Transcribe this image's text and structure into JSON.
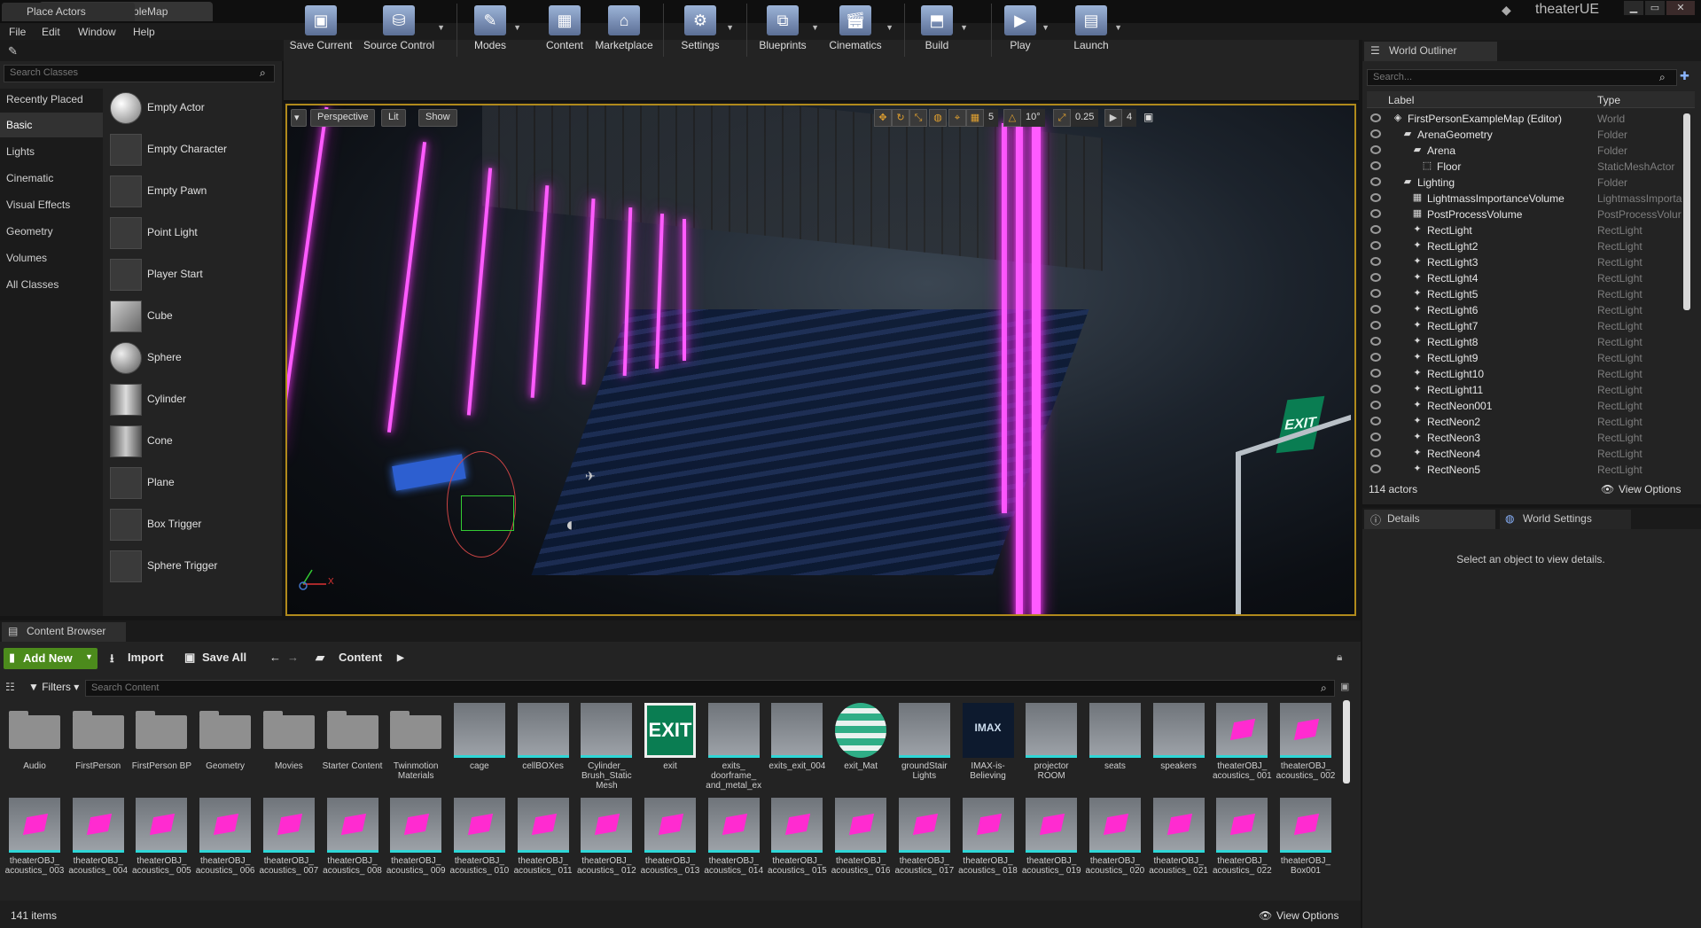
{
  "window": {
    "tab": "FirstPersonExampleMap",
    "project": "theaterUE",
    "min": "▁",
    "max": "▭",
    "close": "✕"
  },
  "menu": [
    "File",
    "Edit",
    "Window",
    "Help"
  ],
  "place_actors": {
    "tab": "Place Actors",
    "search_placeholder": "Search Classes",
    "categories": [
      "Recently Placed",
      "Basic",
      "Lights",
      "Cinematic",
      "Visual Effects",
      "Geometry",
      "Volumes",
      "All Classes"
    ],
    "actors": [
      "Empty Actor",
      "Empty Character",
      "Empty Pawn",
      "Point Light",
      "Player Start",
      "Cube",
      "Sphere",
      "Cylinder",
      "Cone",
      "Plane",
      "Box Trigger",
      "Sphere Trigger"
    ]
  },
  "toolbar": [
    "Save Current",
    "Source Control",
    "Modes",
    "Content",
    "Marketplace",
    "Settings",
    "Blueprints",
    "Cinematics",
    "Build",
    "Play",
    "Launch"
  ],
  "viewport": {
    "perspective": "Perspective",
    "lit": "Lit",
    "show": "Show",
    "grid": "5",
    "angle": "10°",
    "scale": "0.25",
    "cam_speed": "4",
    "exit_text": "EXIT",
    "axis_x": "X"
  },
  "outliner": {
    "tab": "World Outliner",
    "search_placeholder": "Search...",
    "col_label": "Label",
    "col_type": "Type",
    "rows": [
      {
        "label": "FirstPersonExampleMap (Editor)",
        "type": "World"
      },
      {
        "label": "ArenaGeometry",
        "type": "Folder"
      },
      {
        "label": "Arena",
        "type": "Folder"
      },
      {
        "label": "Floor",
        "type": "StaticMeshActor"
      },
      {
        "label": "Lighting",
        "type": "Folder"
      },
      {
        "label": "LightmassImportanceVolume",
        "type": "LightmassImporta"
      },
      {
        "label": "PostProcessVolume",
        "type": "PostProcessVolur"
      },
      {
        "label": "RectLight",
        "type": "RectLight"
      },
      {
        "label": "RectLight2",
        "type": "RectLight"
      },
      {
        "label": "RectLight3",
        "type": "RectLight"
      },
      {
        "label": "RectLight4",
        "type": "RectLight"
      },
      {
        "label": "RectLight5",
        "type": "RectLight"
      },
      {
        "label": "RectLight6",
        "type": "RectLight"
      },
      {
        "label": "RectLight7",
        "type": "RectLight"
      },
      {
        "label": "RectLight8",
        "type": "RectLight"
      },
      {
        "label": "RectLight9",
        "type": "RectLight"
      },
      {
        "label": "RectLight10",
        "type": "RectLight"
      },
      {
        "label": "RectLight11",
        "type": "RectLight"
      },
      {
        "label": "RectNeon001",
        "type": "RectLight"
      },
      {
        "label": "RectNeon2",
        "type": "RectLight"
      },
      {
        "label": "RectNeon3",
        "type": "RectLight"
      },
      {
        "label": "RectNeon4",
        "type": "RectLight"
      },
      {
        "label": "RectNeon5",
        "type": "RectLight"
      }
    ],
    "count": "114 actors",
    "view_options": "View Options"
  },
  "details": {
    "tab": "Details",
    "tab2": "World Settings",
    "empty": "Select an object to view details."
  },
  "content_browser": {
    "tab": "Content Browser",
    "add_new": "Add New",
    "import": "Import",
    "save_all": "Save All",
    "path": "Content",
    "filters": "Filters",
    "search_placeholder": "Search Content",
    "count": "141 items",
    "view_options": "View Options",
    "row1": [
      {
        "label": "Audio",
        "kind": "folder"
      },
      {
        "label": "FirstPerson",
        "kind": "folder"
      },
      {
        "label": "FirstPerson BP",
        "kind": "folder"
      },
      {
        "label": "Geometry",
        "kind": "folder"
      },
      {
        "label": "Movies",
        "kind": "folder"
      },
      {
        "label": "Starter Content",
        "kind": "folder"
      },
      {
        "label": "Twinmotion Materials",
        "kind": "folder"
      },
      {
        "label": "cage",
        "kind": "mesh"
      },
      {
        "label": "cellBOXes",
        "kind": "mesh"
      },
      {
        "label": "Cylinder_ Brush_Static Mesh",
        "kind": "mesh"
      },
      {
        "label": "exit",
        "kind": "exit"
      },
      {
        "label": "exits_ doorframe_ and_metal_ex",
        "kind": "mesh"
      },
      {
        "label": "exits_exit_004",
        "kind": "mesh"
      },
      {
        "label": "exit_Mat",
        "kind": "sphere"
      },
      {
        "label": "groundStair Lights",
        "kind": "mesh"
      },
      {
        "label": "IMAX-is- Believing",
        "kind": "imax"
      },
      {
        "label": "projector ROOM",
        "kind": "mesh"
      },
      {
        "label": "seats",
        "kind": "mesh"
      },
      {
        "label": "speakers",
        "kind": "mesh"
      },
      {
        "label": "theaterOBJ_ acoustics_ 001",
        "kind": "pink"
      },
      {
        "label": "theaterOBJ_ acoustics_ 002",
        "kind": "pink"
      }
    ],
    "row2": [
      {
        "label": "theaterOBJ_ acoustics_ 003"
      },
      {
        "label": "theaterOBJ_ acoustics_ 004"
      },
      {
        "label": "theaterOBJ_ acoustics_ 005"
      },
      {
        "label": "theaterOBJ_ acoustics_ 006"
      },
      {
        "label": "theaterOBJ_ acoustics_ 007"
      },
      {
        "label": "theaterOBJ_ acoustics_ 008"
      },
      {
        "label": "theaterOBJ_ acoustics_ 009"
      },
      {
        "label": "theaterOBJ_ acoustics_ 010"
      },
      {
        "label": "theaterOBJ_ acoustics_ 011"
      },
      {
        "label": "theaterOBJ_ acoustics_ 012"
      },
      {
        "label": "theaterOBJ_ acoustics_ 013"
      },
      {
        "label": "theaterOBJ_ acoustics_ 014"
      },
      {
        "label": "theaterOBJ_ acoustics_ 015"
      },
      {
        "label": "theaterOBJ_ acoustics_ 016"
      },
      {
        "label": "theaterOBJ_ acoustics_ 017"
      },
      {
        "label": "theaterOBJ_ acoustics_ 018"
      },
      {
        "label": "theaterOBJ_ acoustics_ 019"
      },
      {
        "label": "theaterOBJ_ acoustics_ 020"
      },
      {
        "label": "theaterOBJ_ acoustics_ 021"
      },
      {
        "label": "theaterOBJ_ acoustics_ 022"
      },
      {
        "label": "theaterOBJ_ Box001"
      }
    ]
  },
  "colors": {
    "accent": "#b08a1c",
    "neon": "#ff5bff",
    "add_new": "#4c8b1c"
  }
}
